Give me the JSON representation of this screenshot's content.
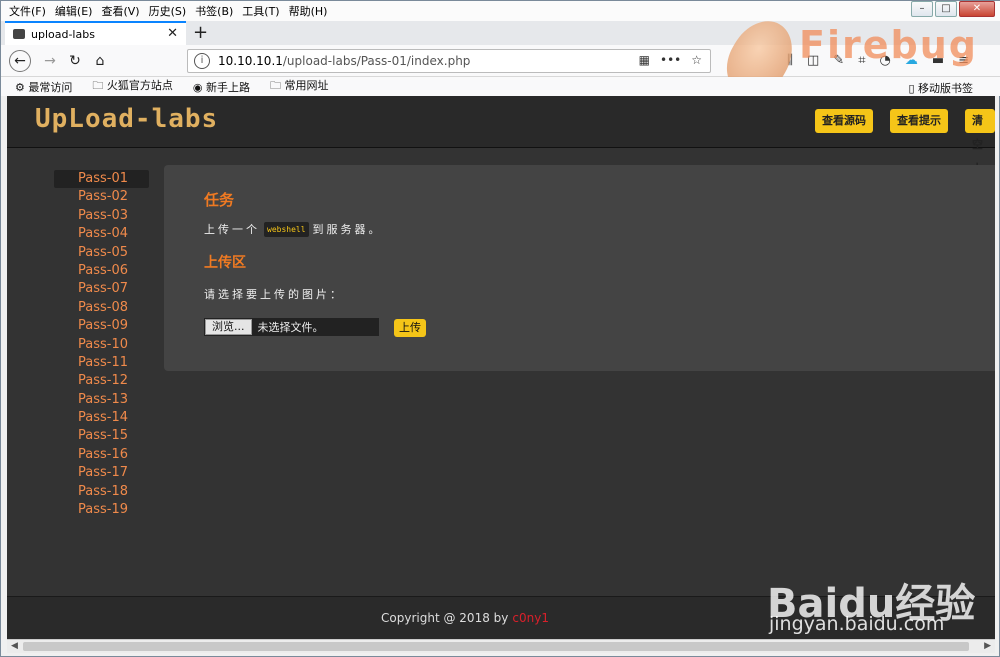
{
  "menu": [
    "文件(F)",
    "编辑(E)",
    "查看(V)",
    "历史(S)",
    "书签(B)",
    "工具(T)",
    "帮助(H)"
  ],
  "tab": {
    "title": "upload-labs"
  },
  "url": {
    "host": "10.10.10.1",
    "path": "/upload-labs/Pass-01/index.php"
  },
  "bookmarks": [
    "最常访问",
    "火狐官方站点",
    "新手上路",
    "常用网址"
  ],
  "bookmarks_mobile": "移动版书签",
  "watermark_firebug": "Firebug",
  "page": {
    "logo": "UpLoad-labs",
    "buttons": {
      "source": "查看源码",
      "hint": "查看提示",
      "clear": "清空上"
    },
    "passes": [
      "Pass-01",
      "Pass-02",
      "Pass-03",
      "Pass-04",
      "Pass-05",
      "Pass-06",
      "Pass-07",
      "Pass-08",
      "Pass-09",
      "Pass-10",
      "Pass-11",
      "Pass-12",
      "Pass-13",
      "Pass-14",
      "Pass-15",
      "Pass-16",
      "Pass-17",
      "Pass-18",
      "Pass-19"
    ],
    "task": {
      "heading": "任务",
      "before": "上传一个",
      "code": "webshell",
      "after": "到服务器。"
    },
    "upload": {
      "heading": "上传区",
      "prompt": "请选择要上传的图片：",
      "browse": "浏览...",
      "no_file": "未选择文件。",
      "submit": "上传"
    },
    "footer": {
      "copyright": "Copyright @ 2018 by",
      "author": "c0ny1"
    }
  },
  "watermark_baidu": {
    "brand": "Baidu经验",
    "url": "jingyan.baidu.com"
  }
}
